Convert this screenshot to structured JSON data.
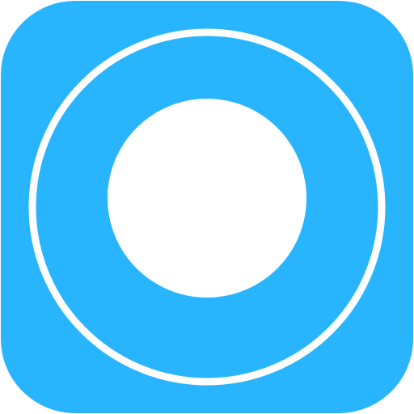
{
  "icon": {
    "name": "record-button-icon",
    "colors": {
      "tile": "#29b5fe",
      "glyph": "#ffffff",
      "page_background": "#ffffff"
    }
  }
}
